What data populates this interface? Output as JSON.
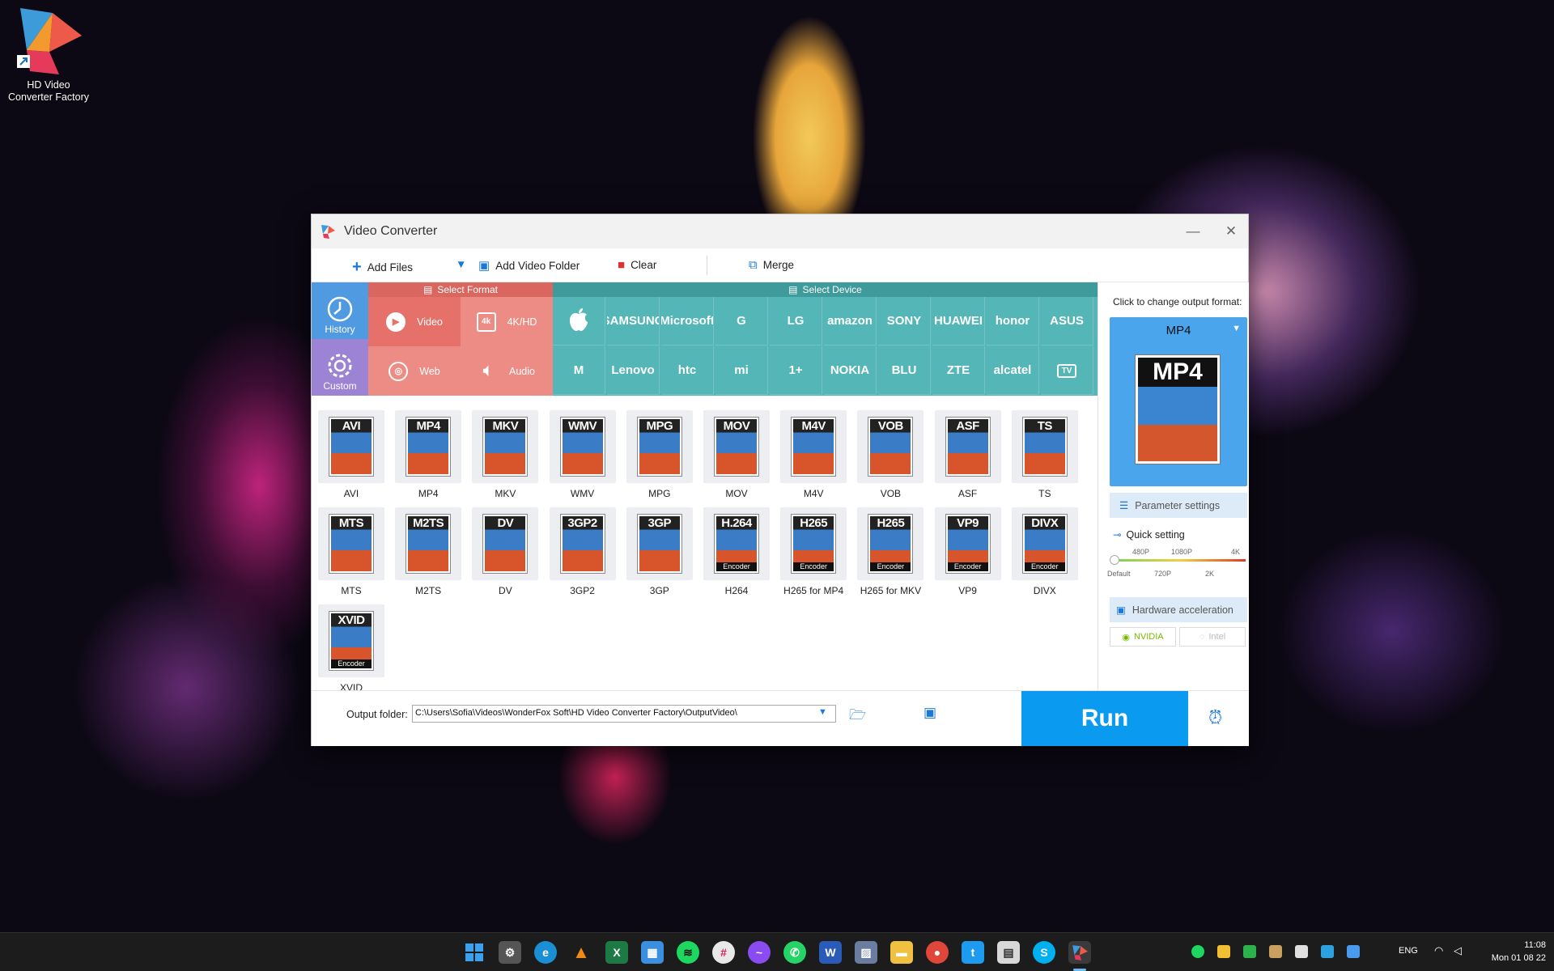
{
  "desktop": {
    "shortcut_label": "HD Video Converter Factory"
  },
  "window": {
    "title": "Video Converter",
    "minimize": "—",
    "close": "✕"
  },
  "toolbar": {
    "add_files": "Add Files",
    "add_folder": "Add Video Folder",
    "clear": "Clear",
    "merge": "Merge"
  },
  "format_bar": {
    "history": "History",
    "custom": "Custom",
    "select_format": "Select Format",
    "select_device": "Select Device",
    "categories": [
      {
        "label": "Video",
        "icon": "play-icon"
      },
      {
        "label": "4K/HD",
        "icon": "4k-icon"
      },
      {
        "label": "Web",
        "icon": "web-icon"
      },
      {
        "label": "Audio",
        "icon": "speaker-icon"
      }
    ],
    "brands_row1": [
      "",
      "SAMSUNG",
      "Microsoft",
      "G",
      "LG",
      "amazon",
      "SONY",
      "HUAWEI",
      "honor",
      "ASUS"
    ],
    "brands_row2": [
      "M",
      "Lenovo",
      "htc",
      "mi",
      "1+",
      "NOKIA",
      "BLU",
      "ZTE",
      "alcatel",
      "TV"
    ]
  },
  "formats": [
    {
      "label": "AVI",
      "tag": "AVI",
      "enc": ""
    },
    {
      "label": "MP4",
      "tag": "MP4",
      "enc": ""
    },
    {
      "label": "MKV",
      "tag": "MKV",
      "enc": ""
    },
    {
      "label": "WMV",
      "tag": "WMV",
      "enc": ""
    },
    {
      "label": "MPG",
      "tag": "MPG",
      "enc": ""
    },
    {
      "label": "MOV",
      "tag": "MOV",
      "enc": ""
    },
    {
      "label": "M4V",
      "tag": "M4V",
      "enc": ""
    },
    {
      "label": "VOB",
      "tag": "VOB",
      "enc": ""
    },
    {
      "label": "ASF",
      "tag": "ASF",
      "enc": ""
    },
    {
      "label": "TS",
      "tag": "TS",
      "enc": ""
    },
    {
      "label": "MTS",
      "tag": "MTS",
      "enc": ""
    },
    {
      "label": "M2TS",
      "tag": "M2TS",
      "enc": ""
    },
    {
      "label": "DV",
      "tag": "DV",
      "enc": ""
    },
    {
      "label": "3GP2",
      "tag": "3GP2",
      "enc": ""
    },
    {
      "label": "3GP",
      "tag": "3GP",
      "enc": ""
    },
    {
      "label": "H264",
      "tag": "H.264",
      "enc": "Encoder"
    },
    {
      "label": "H265 for MP4",
      "tag": "H265",
      "enc": "Encoder"
    },
    {
      "label": "H265 for MKV",
      "tag": "H265",
      "enc": "Encoder"
    },
    {
      "label": "VP9",
      "tag": "VP9",
      "enc": "Encoder"
    },
    {
      "label": "DIVX",
      "tag": "DIVX",
      "enc": "Encoder"
    },
    {
      "label": "XVID",
      "tag": "XVID",
      "enc": "Encoder"
    }
  ],
  "output_panel": {
    "hint": "Click to change output format:",
    "selected": "MP4",
    "param_settings": "Parameter settings",
    "quick_setting": "Quick setting",
    "quality_top": [
      "480P",
      "1080P",
      "4K"
    ],
    "quality_bottom": [
      "Default",
      "720P",
      "2K"
    ],
    "quality_level": 0,
    "hw_accel": "Hardware acceleration",
    "nvidia": "NVIDIA",
    "intel": "Intel"
  },
  "bottom": {
    "output_label": "Output folder:",
    "output_path": "C:\\Users\\Sofia\\Videos\\WonderFox Soft\\HD Video Converter Factory\\OutputVideo\\",
    "run": "Run"
  },
  "taskbar": {
    "lang": "ENG",
    "time": "11:08",
    "date": "Mon 01 08 22"
  },
  "colors": {
    "teal": "#55b6b7",
    "coral": "#e87a72",
    "purple": "#9c83d4",
    "history_blue": "#4f9ae0",
    "run_blue": "#0a9bf0"
  }
}
